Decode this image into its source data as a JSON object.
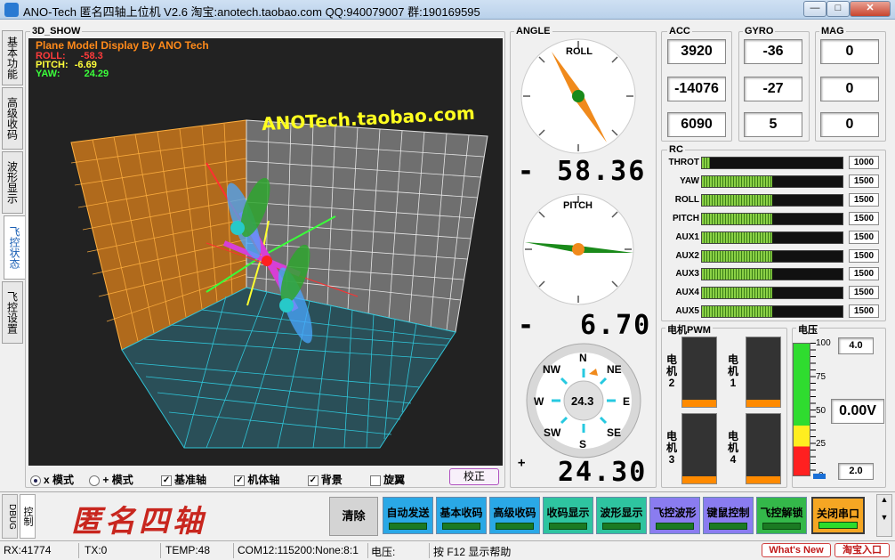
{
  "window": {
    "title": "ANO-Tech    匿名四轴上位机    V2.6    淘宝:anotech.taobao.com    QQ:940079007    群:190169595",
    "minimize": "—",
    "maximize": "□",
    "close": "✕"
  },
  "side_tabs": [
    "基本功能",
    "高级收码",
    "波形显示",
    "飞控状态",
    "飞控设置"
  ],
  "show3d": {
    "group_label": "3D_SHOW",
    "model_title": "Plane Model Display By ANO Tech",
    "roll_label": "ROLL:",
    "roll_value": "-58.3",
    "pitch_label": "PITCH:",
    "pitch_value": "-6.69",
    "yaw_label": "YAW:",
    "yaw_value": "24.29",
    "banner": "ANOTech.taobao.com",
    "colors": {
      "roll": "#ff3b3b",
      "pitch": "#ffff3b",
      "yaw": "#3bff3b",
      "title": "#ff8a1a"
    }
  },
  "options": {
    "x_mode": "x 模式",
    "plus_mode": "+ 模式",
    "base_axis": "基准轴",
    "body_axis": "机体轴",
    "background": "背景",
    "rotor": "旋翼",
    "calibrate": "校正"
  },
  "angle": {
    "group_label": "ANGLE",
    "roll_dial": "ROLL",
    "roll_reading": "58.36",
    "roll_sign": "-",
    "pitch_dial": "PITCH",
    "pitch_reading": "6.70",
    "pitch_sign": "-",
    "compass": {
      "N": "N",
      "NE": "NE",
      "E": "E",
      "SE": "SE",
      "S": "S",
      "SW": "SW",
      "W": "W",
      "NW": "NW",
      "center": "24.3"
    },
    "yaw_reading": "24.30",
    "yaw_sign": "+"
  },
  "acc": {
    "label": "ACC",
    "values": [
      "3920",
      "-14076",
      "6090"
    ]
  },
  "gyro": {
    "label": "GYRO",
    "values": [
      "-36",
      "-27",
      "5"
    ]
  },
  "mag": {
    "label": "MAG",
    "values": [
      "0",
      "0",
      "0"
    ]
  },
  "rc": {
    "label": "RC",
    "channels": [
      {
        "name": "THROT",
        "value": "1000",
        "level": 0.0
      },
      {
        "name": "YAW",
        "value": "1500",
        "level": 0.5
      },
      {
        "name": "ROLL",
        "value": "1500",
        "level": 0.5
      },
      {
        "name": "PITCH",
        "value": "1500",
        "level": 0.5
      },
      {
        "name": "AUX1",
        "value": "1500",
        "level": 0.5
      },
      {
        "name": "AUX2",
        "value": "1500",
        "level": 0.5
      },
      {
        "name": "AUX3",
        "value": "1500",
        "level": 0.5
      },
      {
        "name": "AUX4",
        "value": "1500",
        "level": 0.5
      },
      {
        "name": "AUX5",
        "value": "1500",
        "level": 0.5
      }
    ]
  },
  "motor": {
    "label": "电机PWM",
    "motors": [
      {
        "name": "电机2",
        "level": 0.1
      },
      {
        "name": "电机1",
        "level": 0.1
      },
      {
        "name": "电机3",
        "level": 0.1
      },
      {
        "name": "电机4",
        "level": 0.1
      }
    ]
  },
  "voltage": {
    "label": "电压",
    "ticks": [
      "100",
      "75",
      "50",
      "25",
      "0"
    ],
    "top_value": "4.0",
    "main_value": "0.00V",
    "bottom_value": "2.0"
  },
  "bottom": {
    "debug_tab": "DBUG",
    "control_tab": "控制",
    "logo": "匿名四轴",
    "clear": "清除",
    "buttons": [
      "自动发送",
      "基本收码",
      "高级收码",
      "收码显示",
      "波形显示",
      "飞控波形",
      "键鼠控制",
      "飞控解锁"
    ],
    "close_port": "关闭串口"
  },
  "status": {
    "rx": "RX:41774",
    "tx": "TX:0",
    "temp": "TEMP:48",
    "com": "COM12:115200:None:8:1",
    "voltage": "电压:",
    "help": "按 F12 显示帮助",
    "whats_new": "What's New",
    "shop": "淘宝入口"
  }
}
